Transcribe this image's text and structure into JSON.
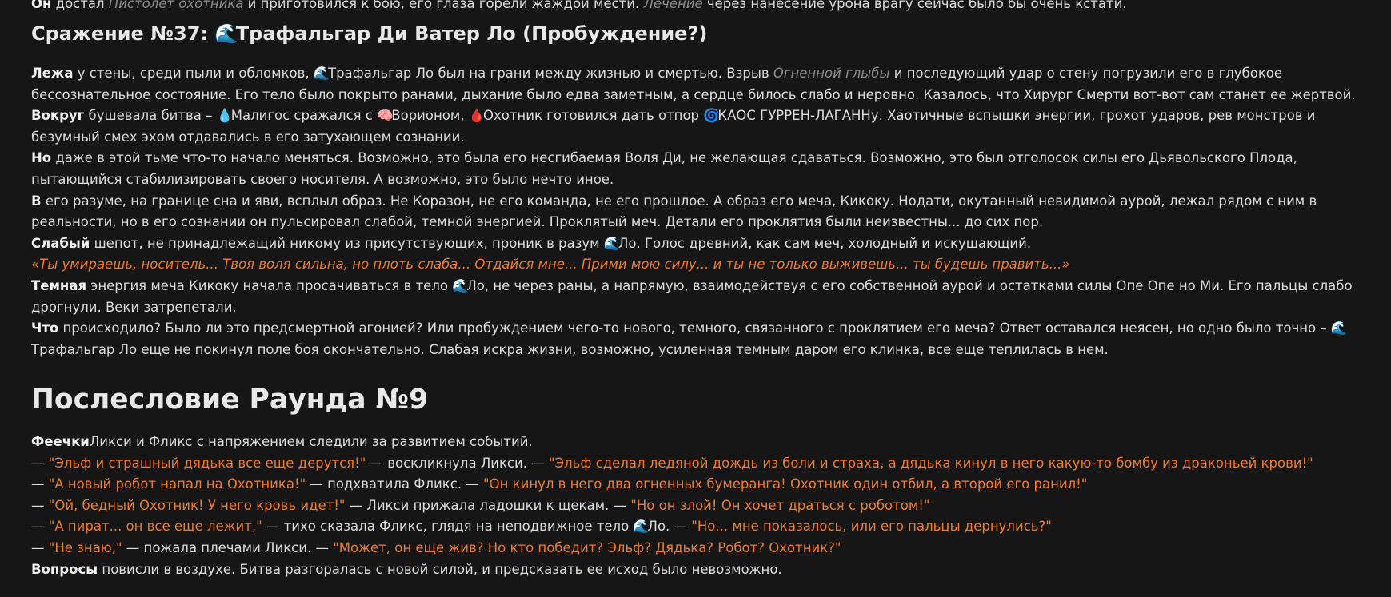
{
  "top_line": {
    "lead": "Он",
    "t1": " достал ",
    "weapon": "Пистолет охотника",
    "t2": " и приготовился к бою, его глаза горели жаждой мести. ",
    "heal": "Лечение",
    "t3": " через нанесение урона врагу сейчас было бы очень кстати."
  },
  "battle_heading": {
    "prefix": "Сражение №37: ",
    "icon": "🌊",
    "name": "Трафальгар Ди Ватер Ло (Пробуждение?)"
  },
  "p1": {
    "lead": "Лежа",
    "t1": " у стены, среди пыли и обломков, ",
    "icon": "🌊",
    "t2": "Трафальгар Ло был на грани между жизнью и смертью. Взрыв ",
    "spell": "Огненной глыбы",
    "t3": " и последующий удар о стену погрузили его в глубокое бессознательное состояние. Его тело было покрыто ранами, дыхание было едва заметным, а сердце билось слабо и неровно. Казалось, что Хирург Смерти вот-вот сам станет ее жертвой."
  },
  "p2": {
    "lead": "Вокруг",
    "t1": " бушевала битва – ",
    "icon1": "💧",
    "t2": "Малигос сражался с ",
    "icon2": "🧠",
    "t3": "Ворионом, ",
    "icon3": "🩸",
    "t4": "Охотник готовился дать отпор ",
    "icon4": "🌀",
    "t5": "КАОС ГУРРЕН-ЛАГАННу. Хаотичные вспышки энергии, грохот ударов, рев монстров и безумный смех эхом отдавались в его затухающем сознании."
  },
  "p3": {
    "lead": "Но",
    "t1": " даже в этой тьме что-то начало меняться. Возможно, это была его несгибаемая Воля Ди, не желающая сдаваться. Возможно, это был отголосок силы его Дьявольского Плода, пытающийся стабилизировать своего носителя. А возможно, это было нечто иное."
  },
  "p4": {
    "lead": "В",
    "t1": " его разуме, на границе сна и яви, всплыл образ. Не Коразон, не его команда, не его прошлое. А образ его меча, Кикоку. Нодати, окутанный невидимой аурой, лежал рядом с ним в реальности, но в его сознании он пульсировал слабой, темной энергией. Проклятый меч. Детали его проклятия были неизвестны... до сих пор."
  },
  "p5": {
    "lead": "Слабый",
    "t1": " шепот, не принадлежащий никому из присутствующих, проник в разум ",
    "icon": "🌊",
    "t2": "Ло. Голос древний, как сам меч, холодный и искушающий."
  },
  "whisper": "«Ты умираешь, носитель... Твоя воля сильна, но плоть слаба... Отдайся мне... Прими мою силу... и ты не только выживешь... ты будешь править...»",
  "p6": {
    "lead": "Темная",
    "t1": " энергия меча Кикоку начала просачиваться в тело ",
    "icon": "🌊",
    "t2": "Ло, не через раны, а напрямую, взаимодействуя с его собственной аурой и остатками силы Опе Опе но Ми. Его пальцы слабо дрогнули. Веки затрепетали."
  },
  "p7": {
    "lead": "Что",
    "t1": " происходило? Было ли это предсмертной агонией? Или пробуждением чего-то нового, темного, связанного с проклятием его меча? Ответ оставался неясен, но одно было точно – ",
    "icon": "🌊",
    "t2": " Трафальгар Ло еще не покинул поле боя окончательно. Слабая искра жизни, возможно, усиленная темным даром его клинка, все еще теплилась в нем."
  },
  "after_heading": "Послесловие Раунда №9",
  "fairies_intro": {
    "lead": "Феечки",
    "t1": "Ликси и Фликс с напряжением следили за развитием событий."
  },
  "dialog": [
    {
      "q1": "\"Эльф и страшный дядька все еще дерутся!\"",
      "mid": " — воскликнула Likси. — ",
      "q2": "\"Эльф сделал ледяной дождь из боли и страха, а дядька кинул в него какую-то бомбу из драконьей крови!\""
    },
    {
      "q1": "\"А новый робот напал на Охотника!\"",
      "mid": " — подхватила Фликс. — ",
      "q2": "\"Он кинул в него два огненных бумеранга! Охотник один отбил, а второй его ранил!\""
    },
    {
      "q1": "\"Ой, бедный Охотник! У него кровь идет!\"",
      "mid": " — Ликси прижала ладошки к щекам. — ",
      "q2": "\"Но он злой! Он хочет драться с роботом!\""
    },
    {
      "q1": "\"А пират... он все еще лежит,\"",
      "mid": " — тихо сказала Фликс, глядя на неподвижное тело ",
      "icon": "🌊",
      "mid2": "Ло. — ",
      "q2": "\"Но... мне показалось, или его пальцы дернулись?\""
    },
    {
      "q1": "\"Не знаю,\"",
      "mid": " — пожала плечами Ликси. — ",
      "q2": "\"Может, он еще жив? Но кто победит? Эльф? Дядька? Робот? Охотник?\""
    }
  ],
  "dash": "— ",
  "final": {
    "lead": "Вопросы",
    "t1": " повисли в воздухе. Битва разгоралась с новой силой, и предсказать ее исход было невозможно."
  },
  "colors": {
    "background": "#161616",
    "text": "#dcdcdc",
    "accent_quote": "#f07c2a",
    "muted_link": "#8c8c8c"
  }
}
